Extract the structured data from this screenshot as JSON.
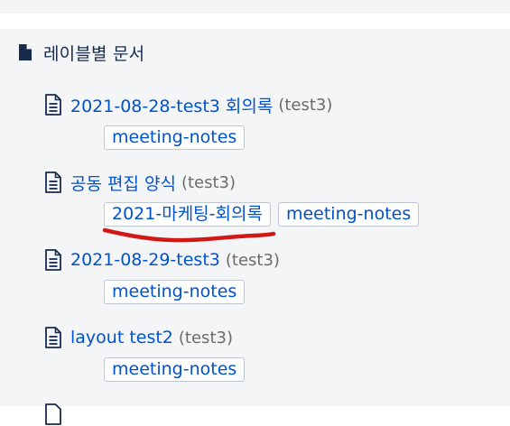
{
  "section": {
    "title": "레이블별 문서",
    "icon": "document-icon"
  },
  "documents": [
    {
      "title": "2021-08-28-test3 회의록",
      "space": "(test3)",
      "labels": [
        "meeting-notes"
      ],
      "icon": "page-icon"
    },
    {
      "title": "공동 편집 양식",
      "space": "(test3)",
      "labels": [
        "2021-마케팅-회의록",
        "meeting-notes"
      ],
      "icon": "page-icon"
    },
    {
      "title": "2021-08-29-test3",
      "space": "(test3)",
      "labels": [
        "meeting-notes"
      ],
      "icon": "page-icon"
    },
    {
      "title": "layout test2",
      "space": "(test3)",
      "labels": [
        "meeting-notes"
      ],
      "icon": "page-icon"
    }
  ],
  "colors": {
    "link": "#0052cc",
    "panel_bg": "#f4f5f7",
    "muted_text": "#6b6b6b",
    "annotation": "#d31717"
  }
}
